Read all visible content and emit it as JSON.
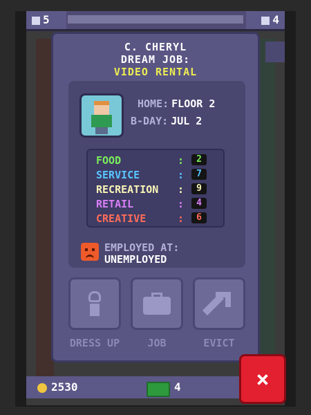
{
  "topbar": {
    "left_value": "5",
    "right_value": "4"
  },
  "card": {
    "name": "C. CHERYL",
    "dream_job_label": "DREAM JOB:",
    "dream_job_value": "VIDEO RENTAL",
    "home_label": "HOME:",
    "home_value": "FLOOR 2",
    "bday_label": "B-DAY:",
    "bday_value": "JUL 2",
    "stats": [
      {
        "label": "FOOD",
        "value": "2",
        "color": "#7aee5a"
      },
      {
        "label": "SERVICE",
        "value": "7",
        "color": "#58c6ff"
      },
      {
        "label": "RECREATION",
        "value": "9",
        "color": "#f8f4b6"
      },
      {
        "label": "RETAIL",
        "value": "4",
        "color": "#d87ff6"
      },
      {
        "label": "CREATIVE",
        "value": "6",
        "color": "#ff6d58"
      }
    ],
    "employed_label": "EMPLOYED AT:",
    "employed_value": "UNEMPLOYED"
  },
  "buttons": {
    "dress_up": "DRESS UP",
    "job": "JOB",
    "evict": "EVICT"
  },
  "bottombar": {
    "coins": "2530",
    "bux": "4"
  },
  "close_icon": "×"
}
